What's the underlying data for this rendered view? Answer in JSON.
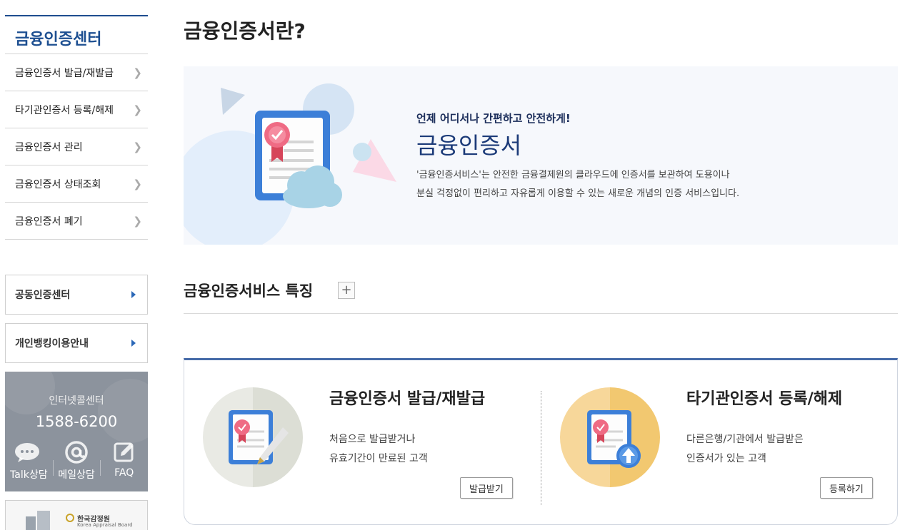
{
  "sidebar": {
    "title": "금융인증센터",
    "items": [
      {
        "label": "금융인증서 발급/재발급"
      },
      {
        "label": "타기관인증서 등록/해제"
      },
      {
        "label": "금융인증서 관리"
      },
      {
        "label": "금융인증서 상태조회"
      },
      {
        "label": "금융인증서 폐기"
      }
    ],
    "links": [
      {
        "label": "공동인증센터"
      },
      {
        "label": "개인뱅킹이용안내"
      }
    ],
    "callcenter": {
      "title": "인터넷콜센터",
      "phone": "1588-6200",
      "actions": [
        {
          "label": "Talk상담",
          "icon": "chat-bubble-icon"
        },
        {
          "label": "메일상담",
          "icon": "at-sign-icon"
        },
        {
          "label": "FAQ",
          "icon": "edit-icon"
        }
      ]
    },
    "banner": {
      "text": "한국감정원",
      "subtext": "Korea Appraisal Board"
    }
  },
  "main": {
    "page_title": "금융인증서란?",
    "hero": {
      "subtitle": "언제 어디서나 간편하고 안전하게!",
      "heading": "금융인증서",
      "desc_line1": "'금융인증서비스'는 안전한 금융결제원의 클라우드에 인증서를 보관하여 도용이나",
      "desc_line2": "분실 걱정없이 편리하고 자유롭게 이용할 수 있는 새로운 개념의 인증 서비스입니다."
    },
    "features": {
      "title": "금융인증서비스 특징",
      "expand_label": "+"
    },
    "services": [
      {
        "name": "금융인증서 발급/재발급",
        "desc_line1": "처음으로 발급받거나",
        "desc_line2": "유효기간이 만료된 고객",
        "button": "발급받기"
      },
      {
        "name": "타기관인증서 등록/해제",
        "desc_line1": "다른은행/기관에서 발급받은",
        "desc_line2": "인증서가 있는 고객",
        "button": "등록하기"
      }
    ]
  },
  "colors": {
    "brand_blue": "#1d4f91",
    "accent_blue": "#466ba8",
    "sidebar_gray": "#8c939d"
  }
}
